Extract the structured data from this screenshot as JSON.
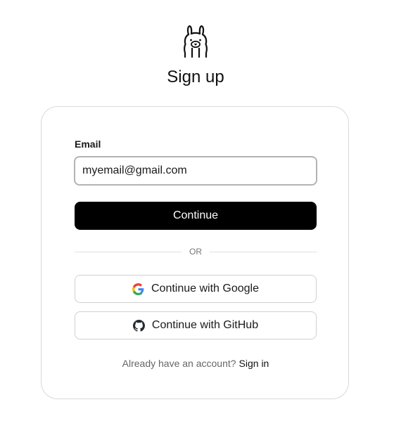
{
  "header": {
    "logo_icon": "llama-logo-icon",
    "title": "Sign up"
  },
  "form": {
    "email_label": "Email",
    "email_value": "myemail@gmail.com",
    "continue_label": "Continue",
    "divider_text": "OR"
  },
  "oauth": {
    "google_label": "Continue with Google",
    "google_icon": "google-icon",
    "github_label": "Continue with GitHub",
    "github_icon": "github-icon"
  },
  "footer": {
    "prompt": "Already have an account?",
    "signin_label": "Sign in"
  },
  "colors": {
    "primary_button": "#000000",
    "card_border": "#d9d9d9",
    "input_border": "#b3b3b3"
  }
}
